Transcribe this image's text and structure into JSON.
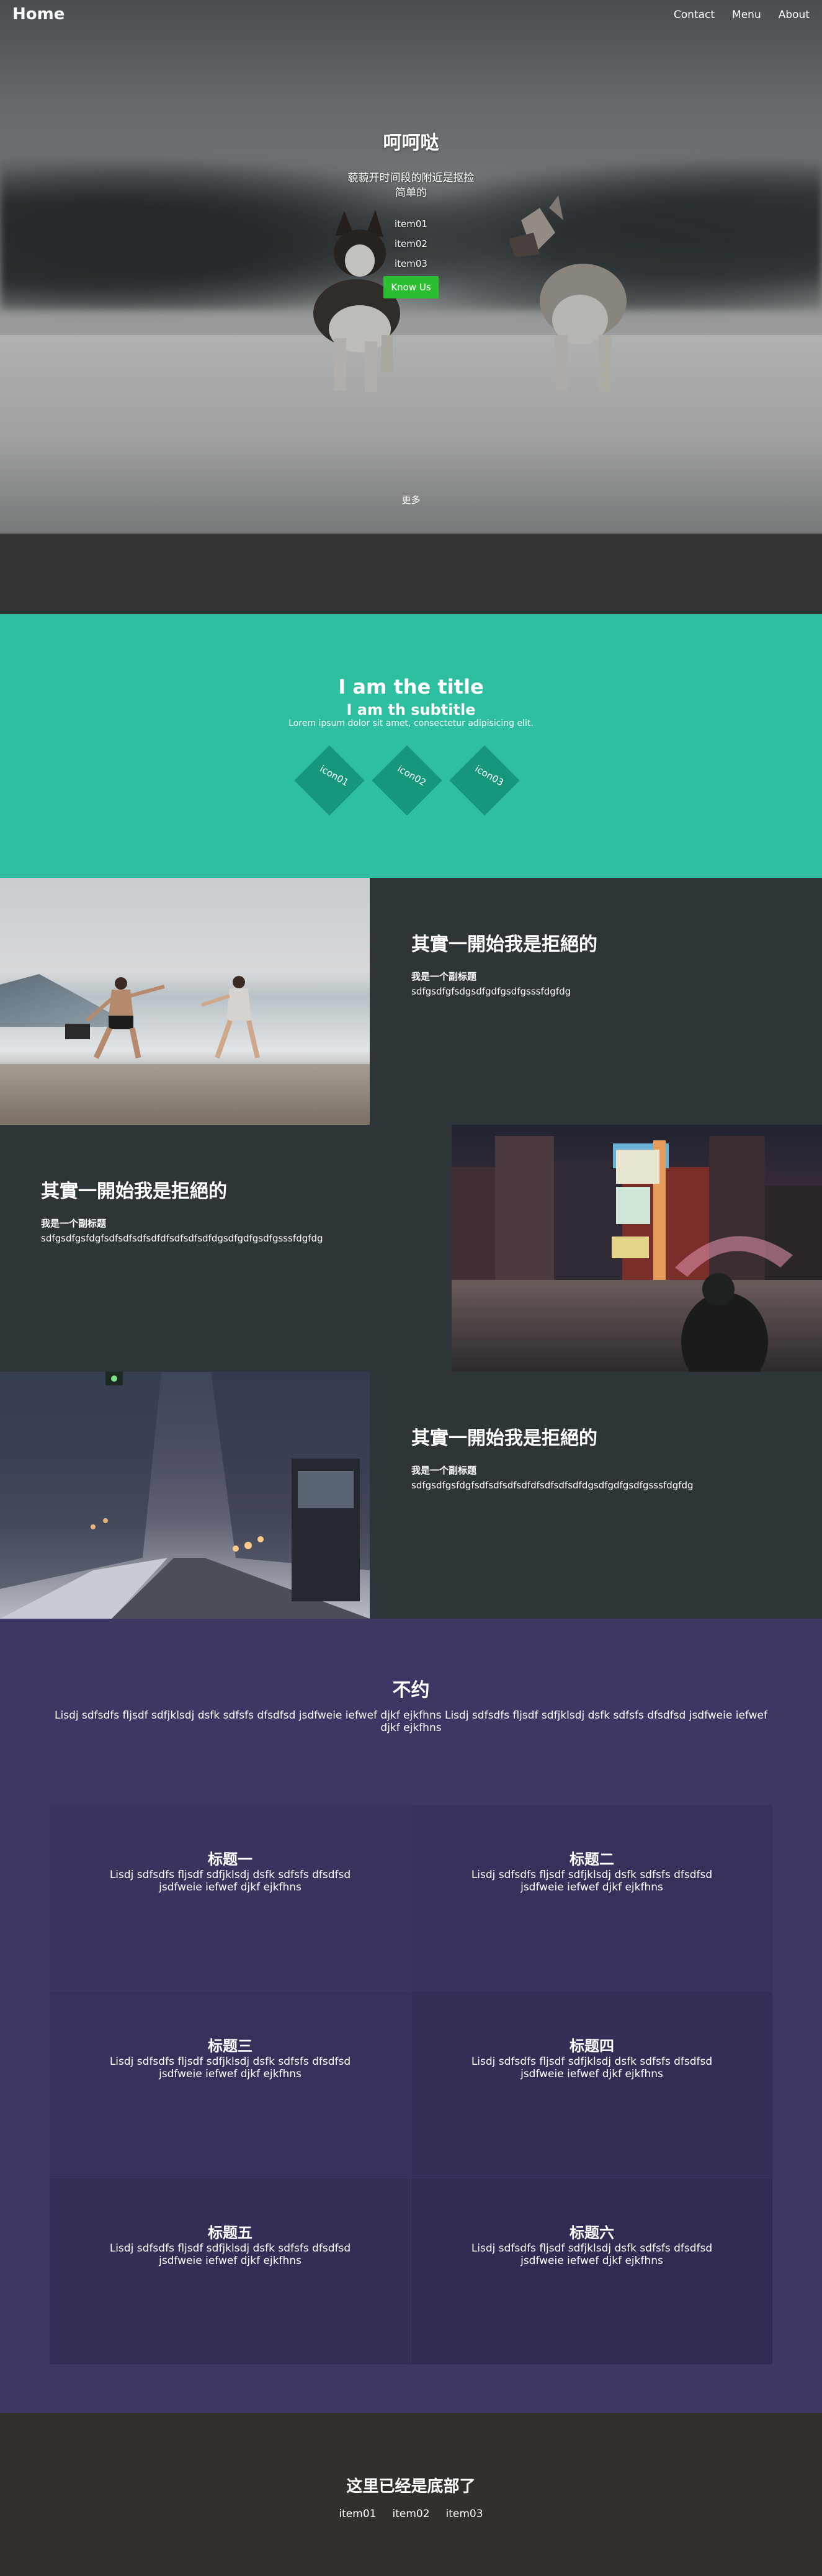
{
  "nav": {
    "brand": "Home",
    "links": [
      "Contact",
      "Menu",
      "About"
    ]
  },
  "hero": {
    "title": "呵呵哒",
    "desc_line1": "藐藐开时间段的附近是抠捡",
    "desc_line2": "简单的",
    "list": [
      "item01",
      "item02",
      "item03"
    ],
    "button": "Know Us",
    "more": "更多"
  },
  "green": {
    "title": "I am the title",
    "subtitle": "I am th subtitle",
    "lorem": "Lorem ipsum dolor sit amet, consectetur adipisicing elit.",
    "icons": [
      "icon01",
      "icon02",
      "icon03"
    ],
    "color": "#2dbf9f",
    "diamond_color": "#16967a"
  },
  "features": [
    {
      "title": "其實一開始我是拒絕的",
      "sub": "我是一个副标题",
      "body": "sdfgsdfgfsdgsdfgdfgsdfgsssfdgfdg"
    },
    {
      "title": "其實一開始我是拒絕的",
      "sub": "我是一个副标题",
      "body": "sdfgsdfgsfdgfsdfsdfsdfsdfdfsdfsdfsdfdgsdfgdfgsdfgsssfdgfdg"
    },
    {
      "title": "其實一開始我是拒絕的",
      "sub": "我是一个副标题",
      "body": "sdfgsdfgsfdgfsdfsdfsdfsdfdfsdfsdfsdfdgsdfgdfgsdfgsssfdgfdg"
    }
  ],
  "purple": {
    "title": "不约",
    "desc": "Lisdj sdfsdfs fljsdf sdfjklsdj dsfk sdfsfs dfsdfsd jsdfweie iefwef djkf ejkfhns Lisdj sdfsdfs fljsdf sdfjklsdj dsfk sdfsfs dfsdfsd jsdfweie iefwef djkf ejkfhns",
    "cells": [
      {
        "title": "标题一",
        "body": "Lisdj sdfsdfs fljsdf sdfjklsdj dsfk sdfsfs dfsdfsd jsdfweie iefwef djkf ejkfhns"
      },
      {
        "title": "标题二",
        "body": "Lisdj sdfsdfs fljsdf sdfjklsdj dsfk sdfsfs dfsdfsd jsdfweie iefwef djkf ejkfhns"
      },
      {
        "title": "标题三",
        "body": "Lisdj sdfsdfs fljsdf sdfjklsdj dsfk sdfsfs dfsdfsd jsdfweie iefwef djkf ejkfhns"
      },
      {
        "title": "标题四",
        "body": "Lisdj sdfsdfs fljsdf sdfjklsdj dsfk sdfsfs dfsdfsd jsdfweie iefwef djkf ejkfhns"
      },
      {
        "title": "标题五",
        "body": "Lisdj sdfsdfs fljsdf sdfjklsdj dsfk sdfsfs dfsdfsd jsdfweie iefwef djkf ejkfhns"
      },
      {
        "title": "标题六",
        "body": "Lisdj sdfsdfs fljsdf sdfjklsdj dsfk sdfsfs dfsdfsd jsdfweie iefwef djkf ejkfhns"
      }
    ],
    "cell_colors": [
      "#39335e",
      "#36315b",
      "#36315b",
      "#332e56",
      "#332e56",
      "#302b52"
    ]
  },
  "footer": {
    "title": "这里已经是底部了",
    "links": [
      "item01",
      "item02",
      "item03"
    ]
  }
}
